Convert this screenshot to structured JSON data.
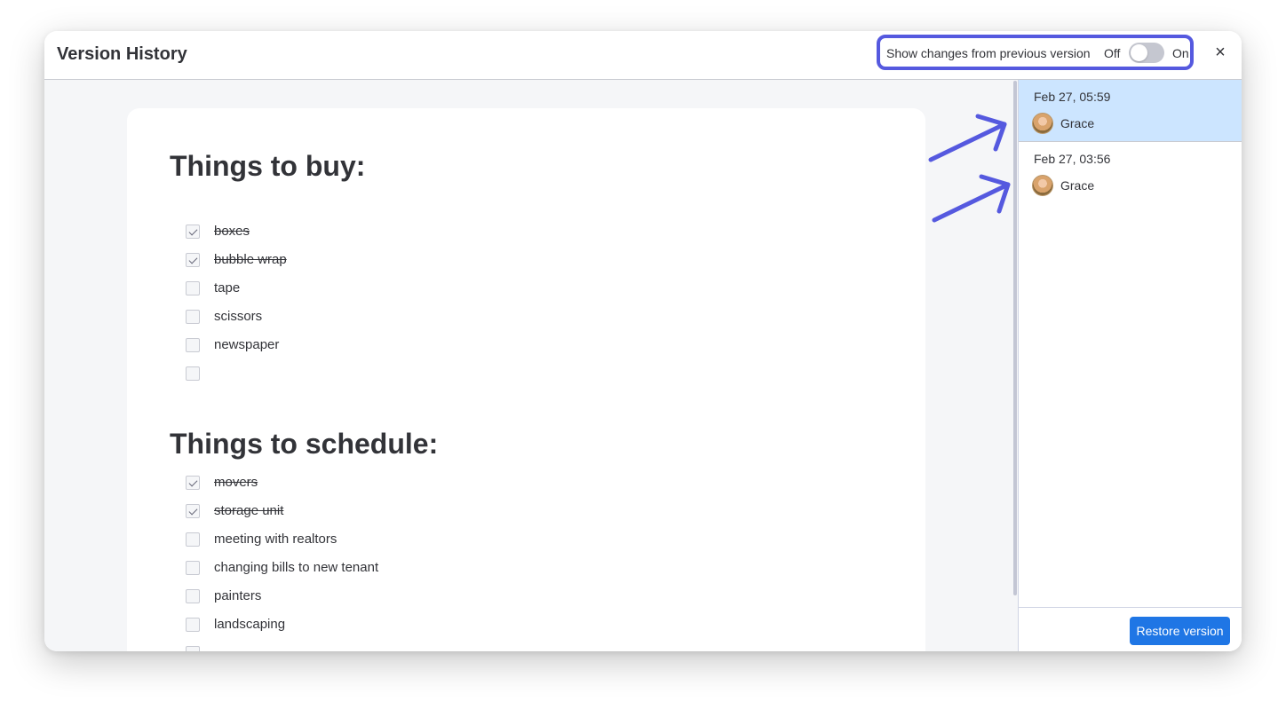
{
  "header": {
    "title": "Version History",
    "toggle_label": "Show changes from previous version",
    "toggle_off": "Off",
    "toggle_on": "On",
    "toggle_state": "off",
    "close_icon": "×"
  },
  "document": {
    "sections": [
      {
        "heading": "Things to buy:",
        "items": [
          {
            "text": "boxes",
            "checked": true
          },
          {
            "text": "bubble wrap",
            "checked": true
          },
          {
            "text": "tape",
            "checked": false
          },
          {
            "text": "scissors",
            "checked": false
          },
          {
            "text": "newspaper",
            "checked": false
          },
          {
            "text": "",
            "checked": false
          }
        ]
      },
      {
        "heading": "Things to schedule:",
        "items": [
          {
            "text": "movers",
            "checked": true
          },
          {
            "text": "storage unit",
            "checked": true
          },
          {
            "text": "meeting with realtors",
            "checked": false
          },
          {
            "text": "changing bills to new tenant",
            "checked": false
          },
          {
            "text": "painters",
            "checked": false
          },
          {
            "text": "landscaping",
            "checked": false
          },
          {
            "text": "",
            "checked": false
          }
        ]
      }
    ]
  },
  "versions": [
    {
      "date": "Feb 27, 05:59",
      "user": "Grace",
      "selected": true
    },
    {
      "date": "Feb 27, 03:56",
      "user": "Grace",
      "selected": false
    }
  ],
  "footer": {
    "restore_label": "Restore version"
  },
  "colors": {
    "accent": "#5559df",
    "selected_version": "#cce5ff",
    "restore_button": "#1f76e5"
  },
  "icons": [
    "close-icon",
    "avatar",
    "arrow-icon"
  ]
}
